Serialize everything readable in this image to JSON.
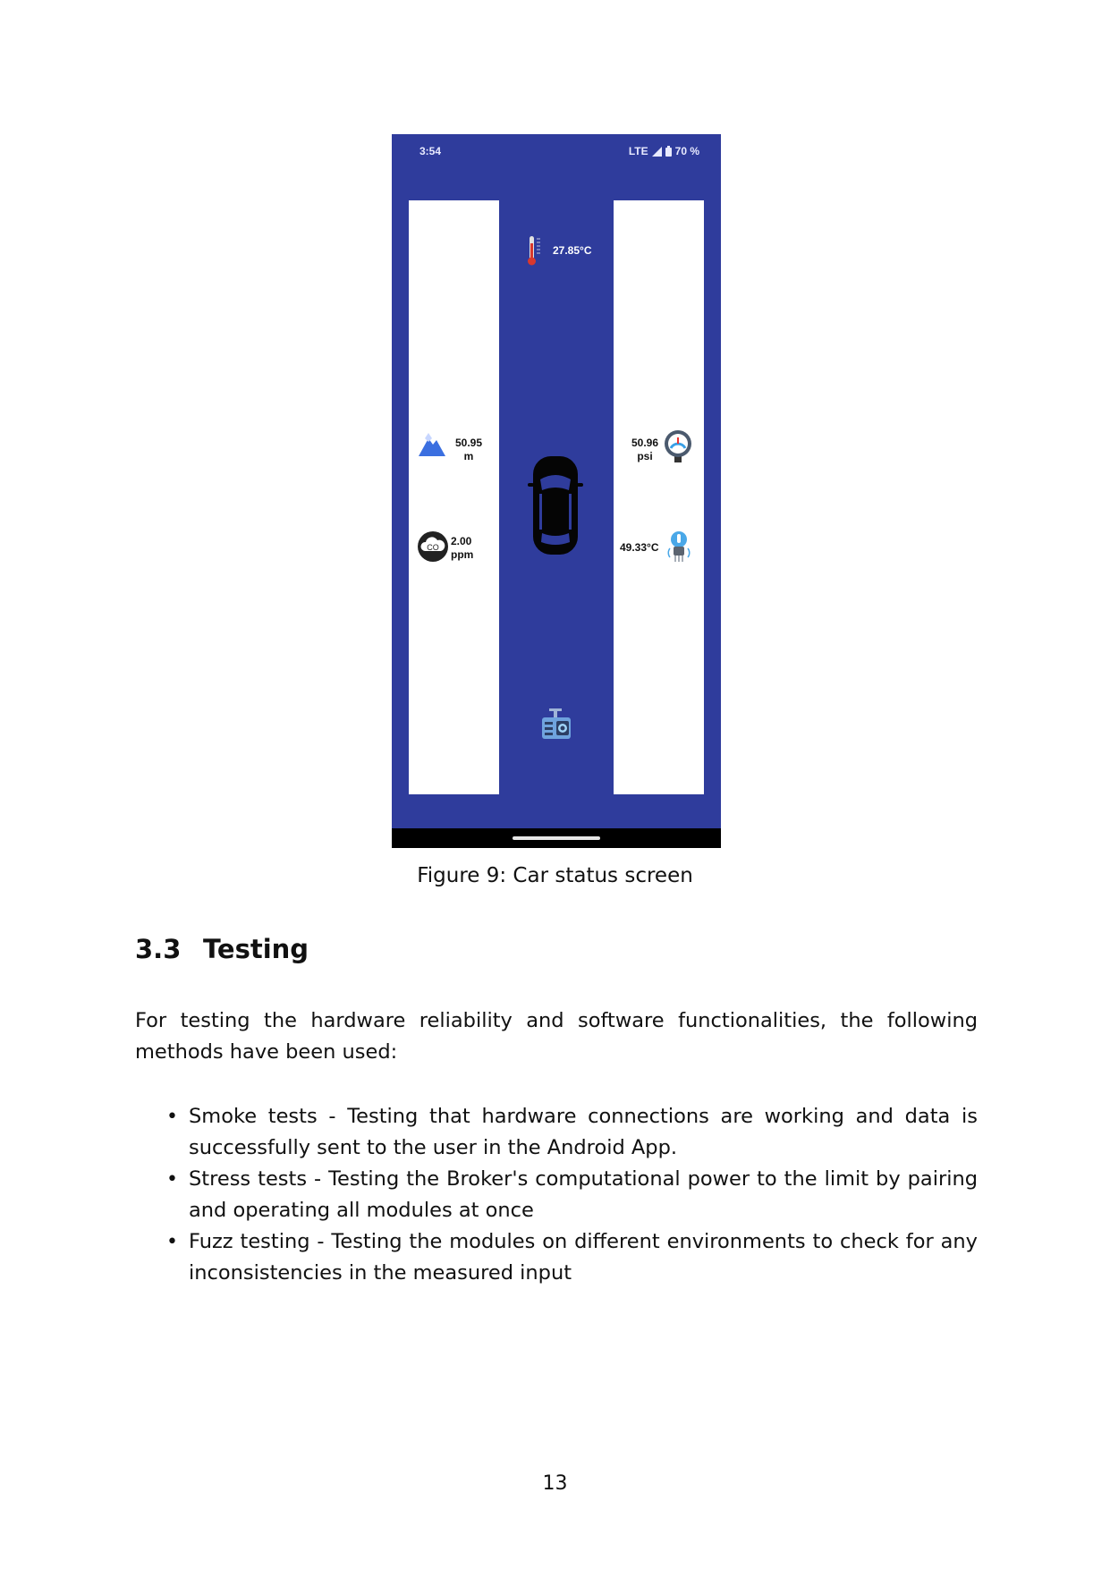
{
  "phone": {
    "status_time": "3:54",
    "status_network": "LTE",
    "status_battery": "70 %",
    "colors": {
      "background": "#2f3c9c",
      "panel": "#ffffff",
      "nav": "#000000"
    },
    "readings": {
      "top_temperature": {
        "value": "27.85°C",
        "icon": "thermometer-icon"
      },
      "altitude": {
        "value": "50.95",
        "unit": "m",
        "icon": "mountain-icon"
      },
      "co": {
        "value": "2.00",
        "unit": "ppm",
        "icon": "co-cloud-icon"
      },
      "pressure": {
        "value": "50.96",
        "unit": "psi",
        "icon": "pressure-gauge-icon"
      },
      "engine_temperature": {
        "value": "49.33°C",
        "icon": "sensor-thermometer-icon"
      }
    },
    "center_icons": [
      "car-icon",
      "camera-module-icon"
    ]
  },
  "caption": "Figure 9:  Car status screen",
  "section": {
    "number": "3.3",
    "title": "Testing"
  },
  "paragraph": "For testing the hardware reliability and software functionalities, the following methods have been used:",
  "bullets": [
    "Smoke tests - Testing that hardware connections are working and data is successfully sent to the user in the Android App.",
    "Stress tests - Testing the Broker's computational power to the limit by pairing and operating all modules at once",
    "Fuzz testing - Testing the modules on different environments to check for any inconsistencies in the measured input"
  ],
  "page_number": "13"
}
